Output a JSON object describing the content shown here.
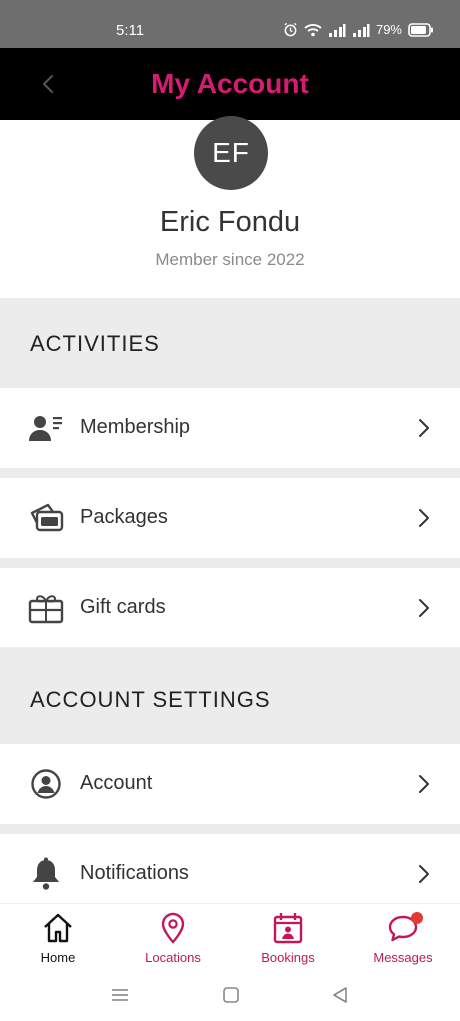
{
  "status_bar": {
    "time": "5:11",
    "battery": "79%"
  },
  "header": {
    "title": "My Account",
    "title_color": "#d81b72",
    "background": "#000000"
  },
  "profile": {
    "initials": "EF",
    "name": "Eric Fondu",
    "member_since": "Member since 2022"
  },
  "sections": [
    {
      "title": "ACTIVITIES",
      "items": [
        {
          "label": "Membership",
          "icon": "membership-card-icon"
        },
        {
          "label": "Packages",
          "icon": "packages-icon"
        },
        {
          "label": "Gift cards",
          "icon": "gift-card-icon"
        }
      ]
    },
    {
      "title": "ACCOUNT SETTINGS",
      "items": [
        {
          "label": "Account",
          "icon": "user-circle-icon"
        },
        {
          "label": "Notifications",
          "icon": "bell-icon"
        }
      ]
    }
  ],
  "bottom_nav": [
    {
      "label": "Home",
      "icon": "home-icon",
      "active": true
    },
    {
      "label": "Locations",
      "icon": "location-pin-icon"
    },
    {
      "label": "Bookings",
      "icon": "calendar-icon"
    },
    {
      "label": "Messages",
      "icon": "chat-bubble-icon",
      "badge": true
    }
  ],
  "colors": {
    "accent": "#c2185b",
    "section_bg": "#ececec",
    "badge": "#e53935"
  }
}
